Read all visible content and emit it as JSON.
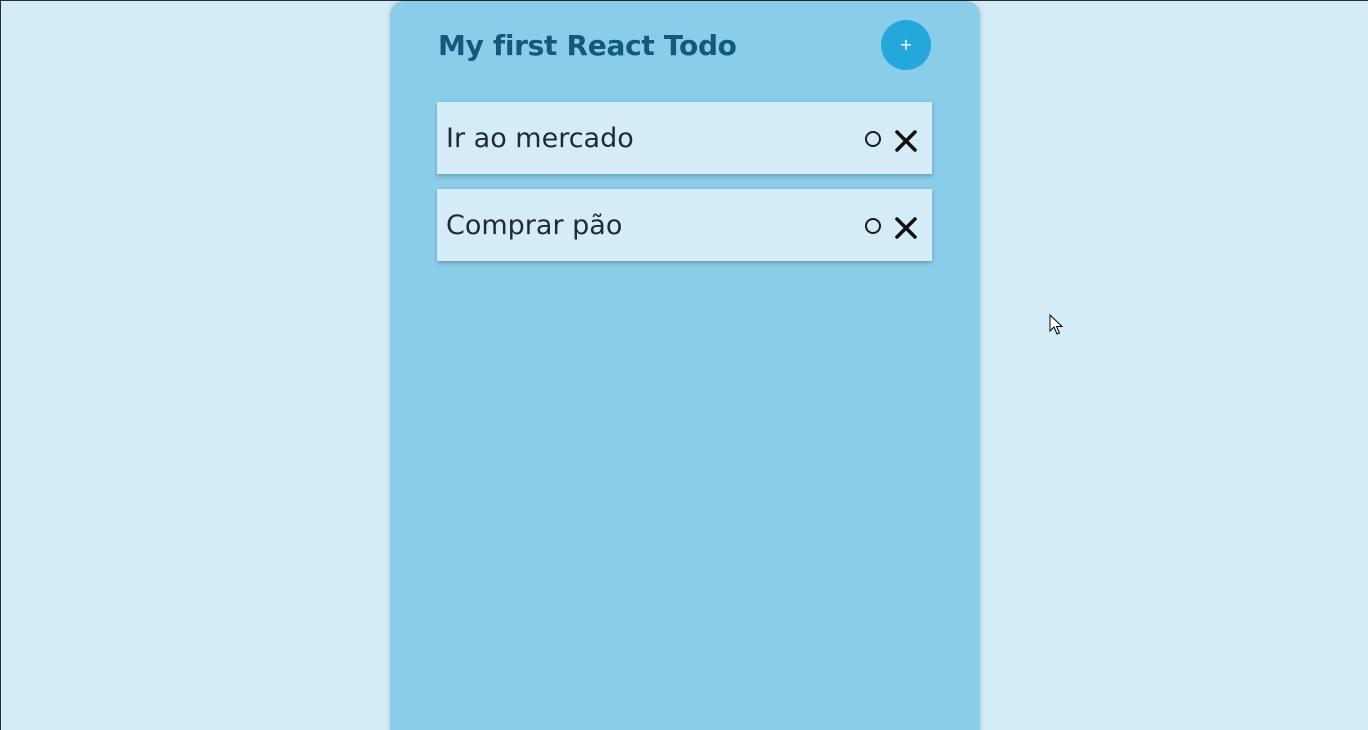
{
  "app": {
    "title": "My first React Todo",
    "add_button_label": "+"
  },
  "todos": [
    {
      "text": "Ir ao mercado",
      "complete_icon": "circle-icon",
      "delete_icon": "x-icon"
    },
    {
      "text": "Comprar pão",
      "complete_icon": "circle-icon",
      "delete_icon": "x-icon"
    }
  ],
  "colors": {
    "background": "#d4ecf7",
    "panel": "#8acde9",
    "title": "#135a7a",
    "add_button": "#25a7dc",
    "todo_item": "#d4ecf7"
  }
}
